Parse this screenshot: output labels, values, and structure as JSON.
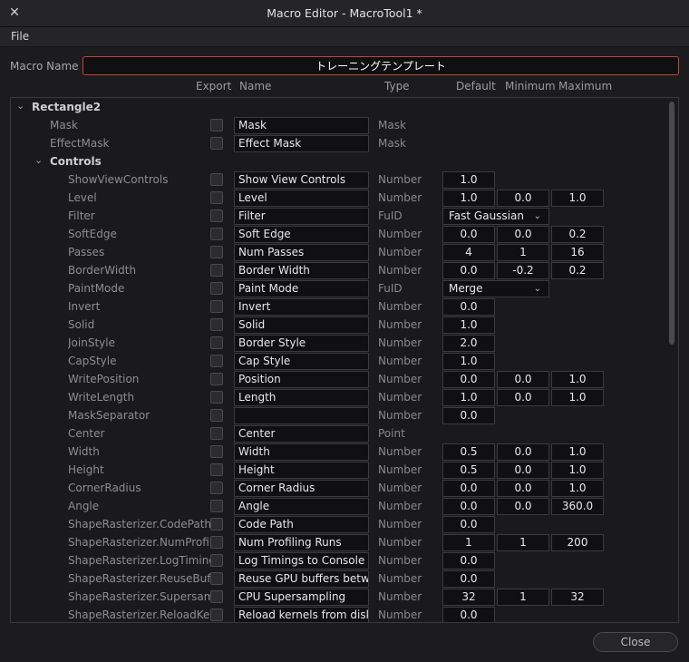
{
  "window": {
    "title": "Macro Editor - MacroTool1 *",
    "close_glyph": "✕"
  },
  "menu": {
    "file": "File"
  },
  "macro_name": {
    "label": "Macro Name",
    "value": "トレーニングテンプレート"
  },
  "columns": {
    "export": "Export",
    "name": "Name",
    "type": "Type",
    "default": "Default",
    "minimum": "Minimum",
    "maximum": "Maximum"
  },
  "tree": {
    "root": "Rectangle2",
    "controls": "Controls"
  },
  "rows": [
    {
      "label": "Mask",
      "name": "Mask",
      "type": "Mask"
    },
    {
      "label": "EffectMask",
      "name": "Effect Mask",
      "type": "Mask"
    },
    {
      "label": "ShowViewControls",
      "name": "Show View Controls",
      "type": "Number",
      "def": "1.0"
    },
    {
      "label": "Level",
      "name": "Level",
      "type": "Number",
      "def": "1.0",
      "min": "0.0",
      "max": "1.0"
    },
    {
      "label": "Filter",
      "name": "Filter",
      "type": "FuID",
      "dropdown": "Fast Gaussian"
    },
    {
      "label": "SoftEdge",
      "name": "Soft Edge",
      "type": "Number",
      "def": "0.0",
      "min": "0.0",
      "max": "0.2"
    },
    {
      "label": "Passes",
      "name": "Num Passes",
      "type": "Number",
      "def": "4",
      "min": "1",
      "max": "16"
    },
    {
      "label": "BorderWidth",
      "name": "Border Width",
      "type": "Number",
      "def": "0.0",
      "min": "-0.2",
      "max": "0.2"
    },
    {
      "label": "PaintMode",
      "name": "Paint Mode",
      "type": "FuID",
      "dropdown": "Merge"
    },
    {
      "label": "Invert",
      "name": "Invert",
      "type": "Number",
      "def": "0.0"
    },
    {
      "label": "Solid",
      "name": "Solid",
      "type": "Number",
      "def": "1.0"
    },
    {
      "label": "JoinStyle",
      "name": "Border Style",
      "type": "Number",
      "def": "2.0"
    },
    {
      "label": "CapStyle",
      "name": "Cap Style",
      "type": "Number",
      "def": "1.0"
    },
    {
      "label": "WritePosition",
      "name": "Position",
      "type": "Number",
      "def": "0.0",
      "min": "0.0",
      "max": "1.0"
    },
    {
      "label": "WriteLength",
      "name": "Length",
      "type": "Number",
      "def": "1.0",
      "min": "0.0",
      "max": "1.0"
    },
    {
      "label": "MaskSeparator",
      "name": "",
      "type": "Number",
      "def": "0.0"
    },
    {
      "label": "Center",
      "name": "Center",
      "type": "Point"
    },
    {
      "label": "Width",
      "name": "Width",
      "type": "Number",
      "def": "0.5",
      "min": "0.0",
      "max": "1.0"
    },
    {
      "label": "Height",
      "name": "Height",
      "type": "Number",
      "def": "0.5",
      "min": "0.0",
      "max": "1.0"
    },
    {
      "label": "CornerRadius",
      "name": "Corner Radius",
      "type": "Number",
      "def": "0.0",
      "min": "0.0",
      "max": "1.0"
    },
    {
      "label": "Angle",
      "name": "Angle",
      "type": "Number",
      "def": "0.0",
      "min": "0.0",
      "max": "360.0"
    },
    {
      "label": "ShapeRasterizer.CodePath",
      "name": "Code Path",
      "type": "Number",
      "def": "0.0"
    },
    {
      "label": "ShapeRasterizer.NumProfilingRuns",
      "name": "Num Profiling Runs",
      "type": "Number",
      "def": "1",
      "min": "1",
      "max": "200"
    },
    {
      "label": "ShapeRasterizer.LogTimings",
      "name": "Log Timings to Console (c",
      "type": "Number",
      "def": "0.0"
    },
    {
      "label": "ShapeRasterizer.ReuseBuffers",
      "name": "Reuse GPU buffers betwe",
      "type": "Number",
      "def": "0.0"
    },
    {
      "label": "ShapeRasterizer.Supersampling",
      "name": "CPU Supersampling",
      "type": "Number",
      "def": "32",
      "min": "1",
      "max": "32"
    },
    {
      "label": "ShapeRasterizer.ReloadKernels",
      "name": "Reload kernels from disk",
      "type": "Number",
      "def": "0.0"
    }
  ],
  "buttons": {
    "close": "Close"
  },
  "icons": {
    "dropdown": "chevron-down-icon",
    "expanded": "chevron-down-icon",
    "close_window": "close-icon"
  }
}
